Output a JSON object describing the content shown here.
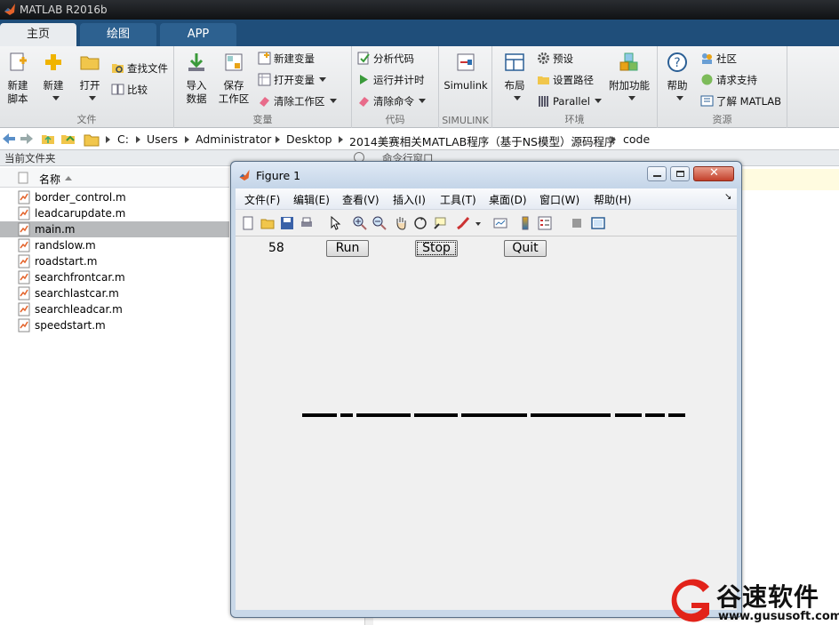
{
  "app": {
    "title": "MATLAB R2016b"
  },
  "tabs": [
    "主页",
    "绘图",
    "APP"
  ],
  "ribbon": {
    "file": {
      "label": "文件",
      "new_script": "新建\n脚本",
      "new": "新建",
      "open": "打开",
      "find_files": "查找文件",
      "compare": "比较"
    },
    "variable": {
      "label": "变量",
      "import": "导入\n数据",
      "save": "保存\n工作区",
      "new_var": "新建变量",
      "open_var": "打开变量",
      "clear_ws": "清除工作区"
    },
    "code": {
      "label": "代码",
      "analyze": "分析代码",
      "run_time": "运行并计时",
      "clear_cmd": "清除命令"
    },
    "simulink": {
      "label": "SIMULINK",
      "simulink": "Simulink"
    },
    "env": {
      "label": "环境",
      "layout": "布局",
      "prefs": "预设",
      "set_path": "设置路径",
      "parallel": "Parallel",
      "addons": "附加功能"
    },
    "resources": {
      "label": "资源",
      "help": "帮助",
      "community": "社区",
      "request_support": "请求支持",
      "learn": "了解 MATLAB"
    }
  },
  "address": {
    "crumbs": [
      "C:",
      "Users",
      "Administrator",
      "Desktop",
      "2014美赛相关MATLAB程序（基于NS模型）源码程序",
      "code"
    ]
  },
  "current_folder": {
    "title": "当前文件夹",
    "col_name": "名称",
    "files": [
      "border_control.m",
      "leadcarupdate.m",
      "main.m",
      "randslow.m",
      "roadstart.m",
      "searchfrontcar.m",
      "searchlastcar.m",
      "searchleadcar.m",
      "speedstart.m"
    ],
    "selected": "main.m"
  },
  "command_window": {
    "title": "命令行窗口"
  },
  "figure": {
    "title": "Figure 1",
    "menu": [
      "文件(F)",
      "编辑(E)",
      "查看(V)",
      "插入(I)",
      "工具(T)",
      "桌面(D)",
      "窗口(W)",
      "帮助(H)"
    ],
    "counter": "58",
    "run": "Run",
    "stop": "Stop",
    "quit": "Quit"
  },
  "watermark": {
    "brand": "谷速软件",
    "url": "www.gususoft.com"
  },
  "colors": {
    "tab_bar": "#1f4e7a",
    "selection": "#b8babc",
    "road": "#000000"
  }
}
